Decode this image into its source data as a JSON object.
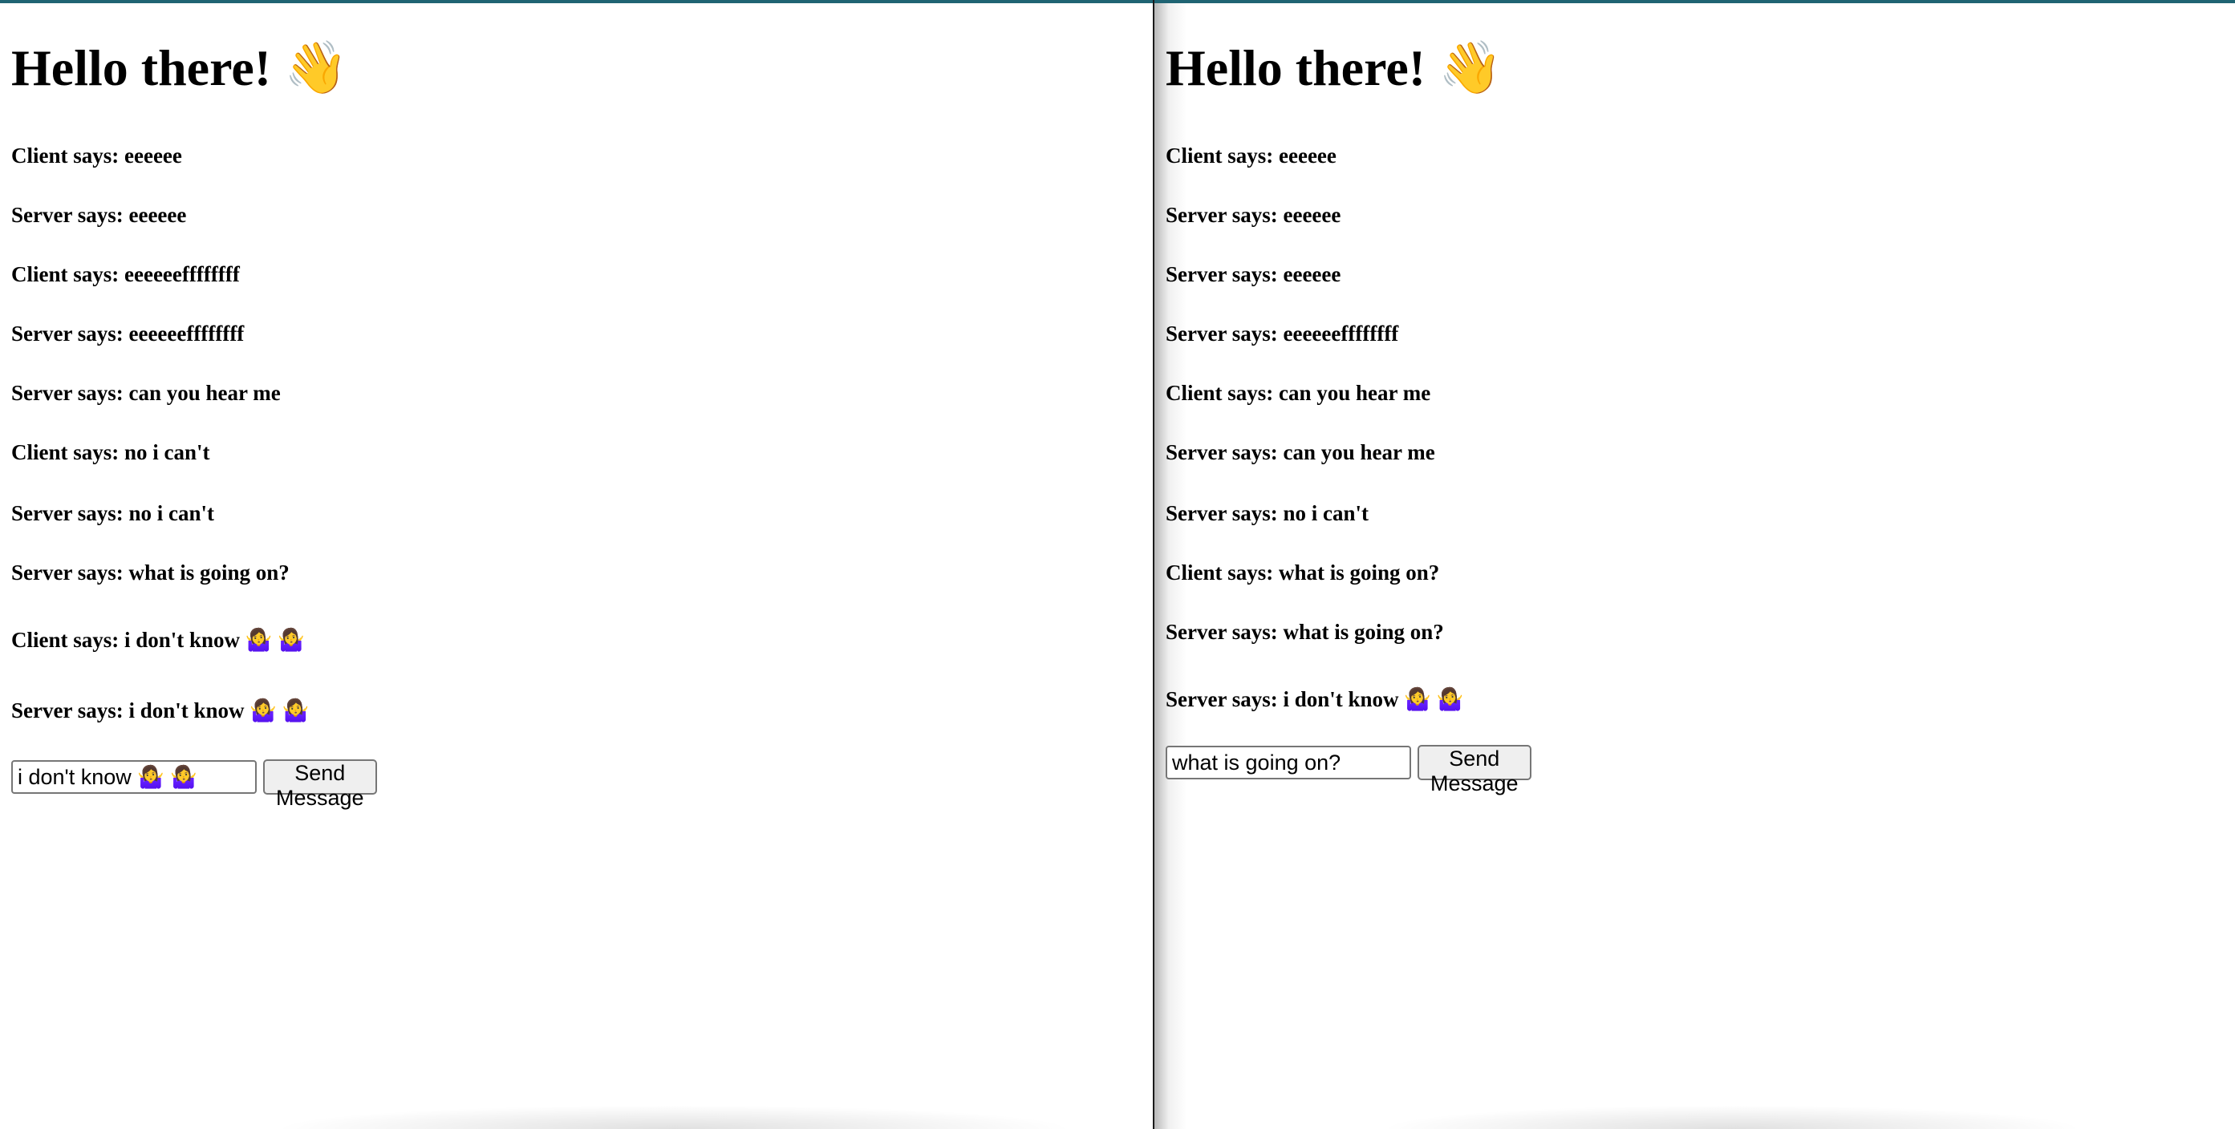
{
  "left_window": {
    "title": "Hello there! 👋",
    "messages": [
      "Client says: eeeeee",
      "Server says: eeeeee",
      "Client says: eeeeeeffffffff",
      "Server says: eeeeeeffffffff",
      "Server says: can you hear me",
      "Client says: no i can't",
      "Server says: no i can't",
      "Server says: what is going on?",
      "Client says: i don't know 🤷‍♀️ 🤷‍♀️",
      "Server says: i don't know 🤷‍♀️ 🤷‍♀️"
    ],
    "input_value": "i don't know 🤷‍♀️ 🤷‍♀️",
    "send_label": "Send Message"
  },
  "right_window": {
    "title": "Hello there! 👋",
    "messages": [
      "Client says: eeeeee",
      "Server says: eeeeee",
      "Server says: eeeeee",
      "Server says: eeeeeeffffffff",
      "Client says: can you hear me",
      "Server says: can you hear me",
      "Server says: no i can't",
      "Client says: what is going on?",
      "Server says: what is going on?",
      "Server says: i don't know 🤷‍♀️ 🤷‍♀️"
    ],
    "input_value": "what is going on?",
    "send_label": "Send Message"
  },
  "colors": {
    "accent": "#1f6473",
    "divider": "#1a1a1a",
    "background": "#ffffff",
    "text": "#000000"
  }
}
